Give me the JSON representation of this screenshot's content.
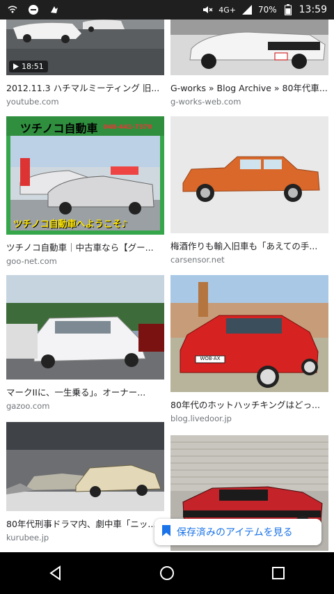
{
  "statusbar": {
    "network": "4G+",
    "battery": "70%",
    "time": "13:59"
  },
  "results": [
    {
      "caption": "2012.11.3 ハチマルミーティング 旧...",
      "source": "youtube.com",
      "duration": "18:51"
    },
    {
      "caption": "G-works » Blog Archive » 80年代車...",
      "source": "g-works-web.com"
    },
    {
      "caption": "ツチノコ自動車｜中古車なら【グー...",
      "source": "goo-net.com",
      "sign_text": "ツチノコ自動車",
      "sign_phone": "048-441-7370",
      "banner_text": "ツチノコ自動車へようこそ♪"
    },
    {
      "caption": "梅酒作りも輸入旧車も「あえての手...",
      "source": "carsensor.net"
    },
    {
      "caption": "マークIIに、一生乗る」。オーナー...",
      "source": "gazoo.com"
    },
    {
      "caption": "80年代のホットハッチキングはどっ...",
      "source": "blog.livedoor.jp",
      "plate_text": "WOB·AX 689"
    },
    {
      "caption": "80年代刑事ドラマ内、劇中車「ニッ...",
      "source": "kurubee.jp"
    },
    {
      "caption": "",
      "source": ""
    }
  ],
  "saved_chip": {
    "label": "保存済みのアイテムを見る"
  },
  "colors": {
    "accent": "#1a73e8",
    "caption": "#202124",
    "source": "#70757a"
  }
}
